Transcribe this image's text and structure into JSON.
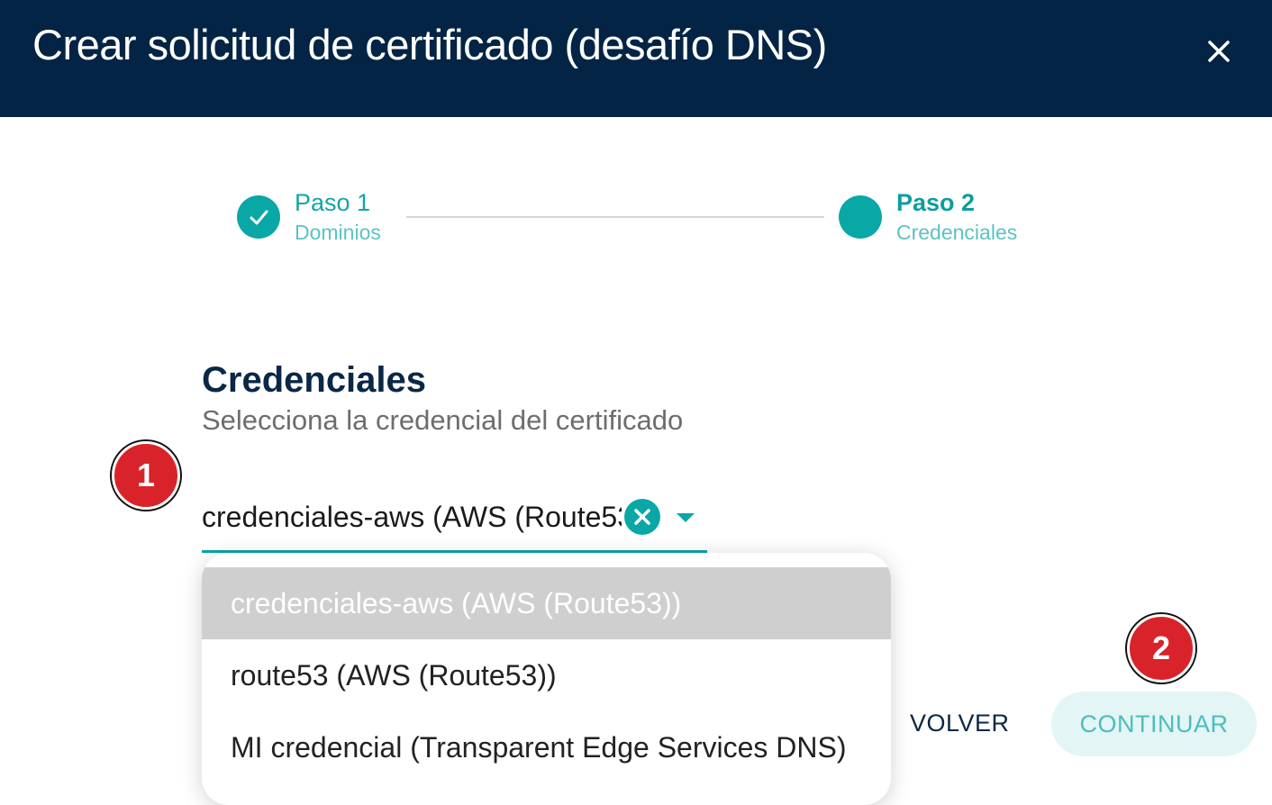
{
  "dialog": {
    "title": "Crear solicitud de certificado (desafío DNS)"
  },
  "stepper": {
    "steps": [
      {
        "title": "Paso 1",
        "subtitle": "Dominios",
        "status": "completed"
      },
      {
        "title": "Paso 2",
        "subtitle": "Credenciales",
        "status": "active"
      }
    ]
  },
  "section": {
    "title": "Credenciales",
    "subtitle": "Selecciona la credencial del certificado"
  },
  "credential_select": {
    "value": "credenciales-aws (AWS (Route53))",
    "options": [
      "credenciales-aws (AWS (Route53))",
      "route53 (AWS (Route53))",
      "MI credencial (Transparent Edge Services DNS)"
    ],
    "selected_index": 0
  },
  "markers": [
    "1",
    "2"
  ],
  "actions": {
    "back_label": "VOLVER",
    "continue_label": "CONTINUAR"
  },
  "colors": {
    "header_bg": "#032444",
    "accent": "#0aa7a7",
    "marker": "#d9232a"
  }
}
